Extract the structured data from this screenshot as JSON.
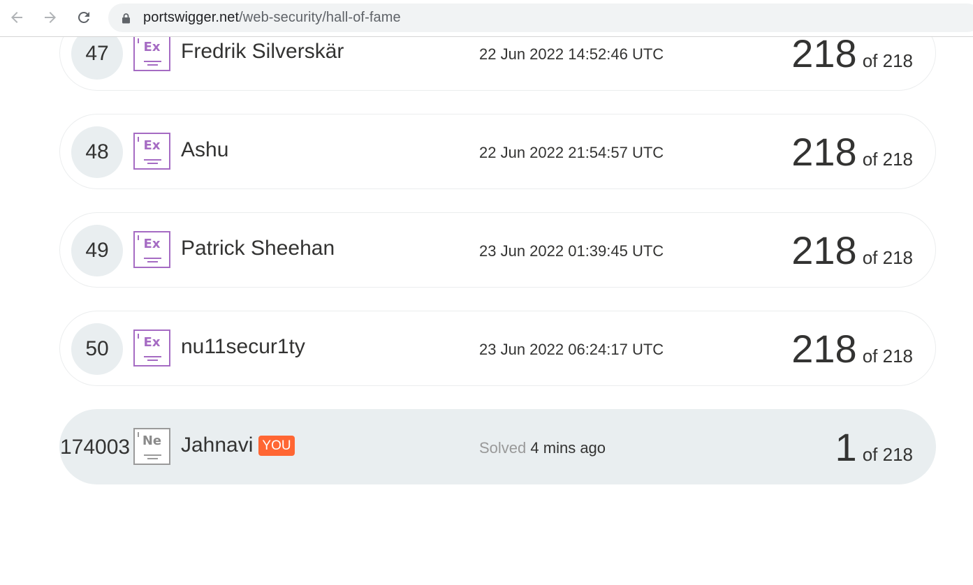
{
  "browser": {
    "url_host": "portswigger.net",
    "url_path": "/web-security/hall-of-fame"
  },
  "leaderboard": {
    "rows": [
      {
        "rank": "47",
        "badge": "Ex",
        "name": "Fredrik Silverskär",
        "date": "22 Jun 2022 14:52:46 UTC",
        "score": "218",
        "of_total": "of 218"
      },
      {
        "rank": "48",
        "badge": "Ex",
        "name": "Ashu",
        "date": "22 Jun 2022 21:54:57 UTC",
        "score": "218",
        "of_total": "of 218"
      },
      {
        "rank": "49",
        "badge": "Ex",
        "name": "Patrick Sheehan",
        "date": "23 Jun 2022 01:39:45 UTC",
        "score": "218",
        "of_total": "of 218"
      },
      {
        "rank": "50",
        "badge": "Ex",
        "name": "nu11secur1ty",
        "date": "23 Jun 2022 06:24:17 UTC",
        "score": "218",
        "of_total": "of 218"
      }
    ],
    "you_row": {
      "rank": "174003",
      "badge": "Ne",
      "name": "Jahnavi",
      "you_tag": "YOU",
      "solved_label": "Solved",
      "solved_time": "4 mins ago",
      "score": "1",
      "of_total": "of 218"
    }
  },
  "colors": {
    "expert_badge": "#a56bc3",
    "novice_badge": "#9a9a9a",
    "you_tag": "#ff6633",
    "rank_circle": "#e9eef0"
  }
}
